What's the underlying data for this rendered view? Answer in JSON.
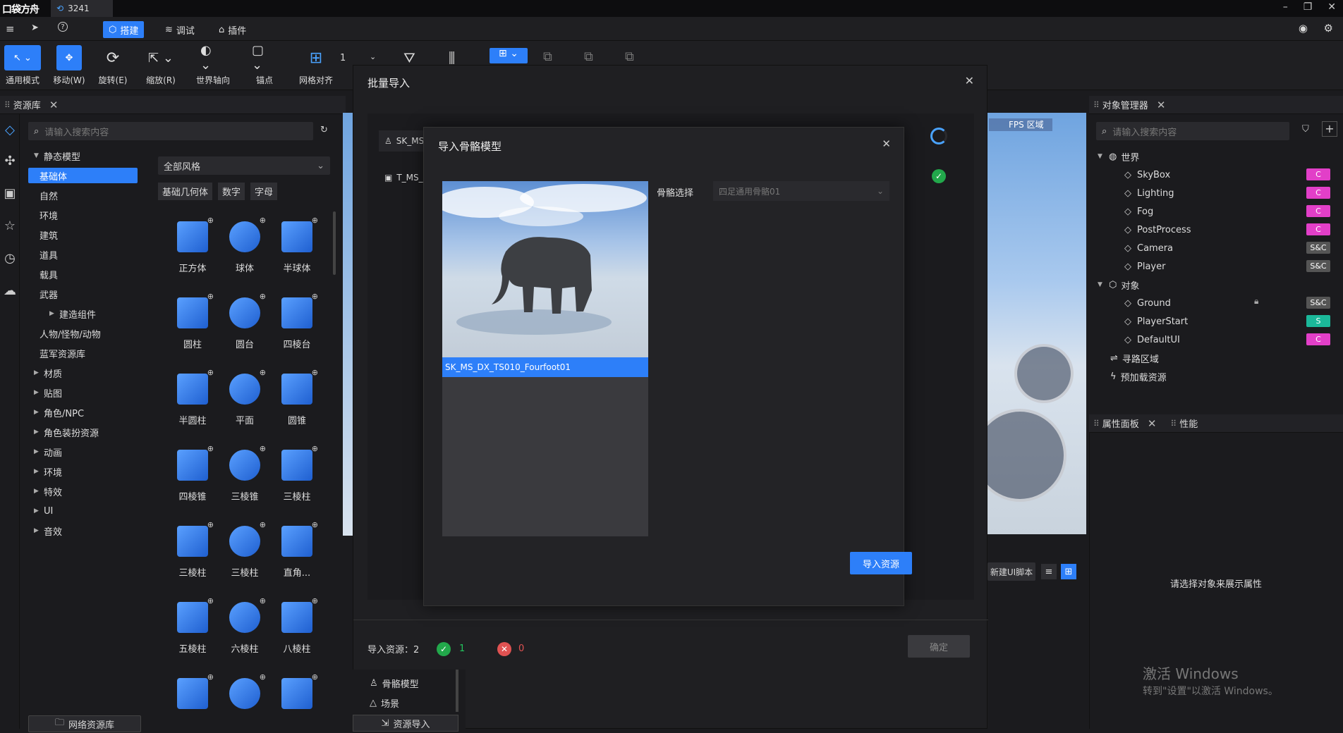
{
  "app": {
    "logo": "口袋方舟",
    "tab_title": "3241"
  },
  "menu": {
    "tabs": [
      {
        "label": "搭建",
        "active": true
      },
      {
        "label": "调试",
        "active": false
      },
      {
        "label": "插件",
        "active": false
      }
    ]
  },
  "toolbar": {
    "tools": [
      "通用模式",
      "移动(W)",
      "旋转(E)",
      "缩放(R)",
      "世界轴向",
      "锚点",
      "网格对齐"
    ],
    "grid_value": "1"
  },
  "asset_panel": {
    "title": "资源库",
    "search_placeholder": "请输入搜索内容",
    "style_select": "全部风格",
    "filters": [
      "基础几何体",
      "数字",
      "字母"
    ],
    "tree": [
      {
        "label": "静态模型",
        "level": 0,
        "expanded": true
      },
      {
        "label": "基础体",
        "level": 1,
        "selected": true
      },
      {
        "label": "自然",
        "level": 1
      },
      {
        "label": "环境",
        "level": 1
      },
      {
        "label": "建筑",
        "level": 1
      },
      {
        "label": "道具",
        "level": 1
      },
      {
        "label": "载具",
        "level": 1
      },
      {
        "label": "武器",
        "level": 1
      },
      {
        "label": "建造组件",
        "level": 2,
        "collapsed": true
      },
      {
        "label": "人物/怪物/动物",
        "level": 1
      },
      {
        "label": "蓝军资源库",
        "level": 1
      },
      {
        "label": "材质",
        "level": 0,
        "collapsed": true
      },
      {
        "label": "贴图",
        "level": 0,
        "collapsed": true
      },
      {
        "label": "角色/NPC",
        "level": 0,
        "collapsed": true
      },
      {
        "label": "角色装扮资源",
        "level": 0,
        "collapsed": true
      },
      {
        "label": "动画",
        "level": 0,
        "collapsed": true
      },
      {
        "label": "环境",
        "level": 0,
        "collapsed": true
      },
      {
        "label": "特效",
        "level": 0,
        "collapsed": true
      },
      {
        "label": "UI",
        "level": 0,
        "collapsed": true
      },
      {
        "label": "音效",
        "level": 0,
        "collapsed": true
      }
    ],
    "items": [
      "正方体",
      "球体",
      "半球体",
      "圆柱",
      "圆台",
      "四棱台",
      "半圆柱",
      "平面",
      "圆锥",
      "四棱锥",
      "三棱锥",
      "三棱柱",
      "三棱柱",
      "三棱柱",
      "直角...",
      "五棱柱",
      "六棱柱",
      "八棱柱",
      "",
      "",
      ""
    ],
    "net_button": "网络资源库"
  },
  "object_manager": {
    "title": "对象管理器",
    "search_placeholder": "请输入搜索内容",
    "world_label": "世界",
    "world_items": [
      {
        "label": "SkyBox",
        "badge": "C",
        "badge_color": "#e23fc8"
      },
      {
        "label": "Lighting",
        "badge": "C",
        "badge_color": "#e23fc8"
      },
      {
        "label": "Fog",
        "badge": "C",
        "badge_color": "#e23fc8"
      },
      {
        "label": "PostProcess",
        "badge": "C",
        "badge_color": "#e23fc8"
      },
      {
        "label": "Camera",
        "badge": "S&C",
        "badge_color": "#555"
      },
      {
        "label": "Player",
        "badge": "S&C",
        "badge_color": "#555"
      }
    ],
    "object_label": "对象",
    "object_items": [
      {
        "label": "Ground",
        "badge": "S&C",
        "badge_color": "#555",
        "locked": true
      },
      {
        "label": "PlayerStart",
        "badge": "S",
        "badge_color": "#1bb89a"
      },
      {
        "label": "DefaultUI",
        "badge": "C",
        "badge_color": "#e23fc8"
      }
    ],
    "extra": [
      "寻路区域",
      "预加载资源"
    ]
  },
  "property_panel": {
    "tabs": [
      "属性面板",
      "性能"
    ],
    "empty_text": "请选择对象来展示属性"
  },
  "viewport": {
    "fps_label": "FPS 区域"
  },
  "batch_import": {
    "title": "批量导入",
    "files": [
      "SK_MS",
      "T_MS_"
    ],
    "summary_label": "导入资源：2",
    "success_count": "1",
    "fail_count": "0",
    "confirm": "确定",
    "bottom_tabs": [
      "骨骼模型",
      "场景",
      "资源导入"
    ]
  },
  "bone_dialog": {
    "title": "导入骨骼模型",
    "model_name": "SK_MS_DX_TS010_Fourfoot01",
    "skeleton_label": "骨骼选择",
    "skeleton_value": "四足通用骨骼01",
    "import_button": "导入资源"
  },
  "side_buttons": {
    "new_ui_script": "新建UI脚本"
  },
  "windows_watermark": {
    "line1": "激活 Windows",
    "line2": "转到\"设置\"以激活 Windows。"
  }
}
